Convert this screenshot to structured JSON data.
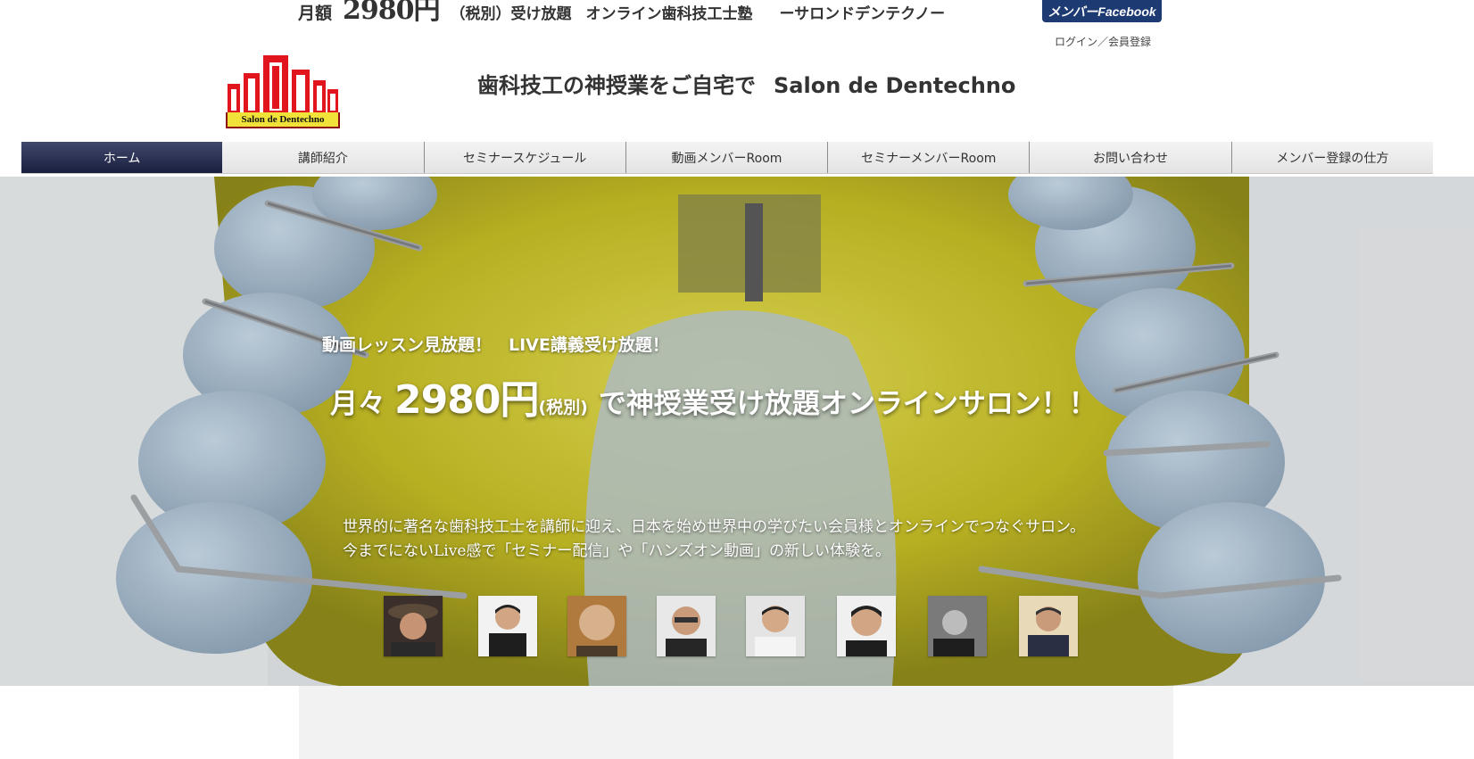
{
  "topbar": {
    "price_label": "月額",
    "price": "2980円",
    "tax_note": "（税別）受け放題",
    "school_name": "オンライン歯科技工士塾",
    "school_sub": "ーサロンドデンテクノー",
    "facebook_button": "メンバーFacebook",
    "login_link": "ログイン／会員登録"
  },
  "logo": {
    "text": "Salon de Dentechno",
    "color": "#e0151e"
  },
  "header": {
    "tagline": "歯科技工の神授業をご自宅で",
    "brand": "Salon de Dentechno"
  },
  "nav": {
    "items": [
      {
        "label": "ホーム",
        "active": true
      },
      {
        "label": "講師紹介"
      },
      {
        "label": "セミナースケジュール"
      },
      {
        "label": "動画メンバーRoom"
      },
      {
        "label": "セミナーメンバーRoom"
      },
      {
        "label": "お問い合わせ"
      },
      {
        "label": "メンバー登録の仕方"
      }
    ]
  },
  "hero": {
    "subtitle": "動画レッスン見放題！　LIVE講義受け放題！",
    "title_pre": "月々",
    "title_price": "2980円",
    "title_tax": "(税別)",
    "title_post": "で神授業受け放題オンラインサロン！！",
    "desc_line1": "世界的に著名な歯科技工士を講師に迎え、日本を始め世界中の学びたい会員様とオンラインでつなぐサロン。",
    "desc_line2": "今までにないLive感で「セミナー配信」や「ハンズオン動画」の新しい体験を。"
  },
  "colors": {
    "nav_active": "#262c4d",
    "facebook": "#1e3a73",
    "appliance": "#c9c235"
  }
}
